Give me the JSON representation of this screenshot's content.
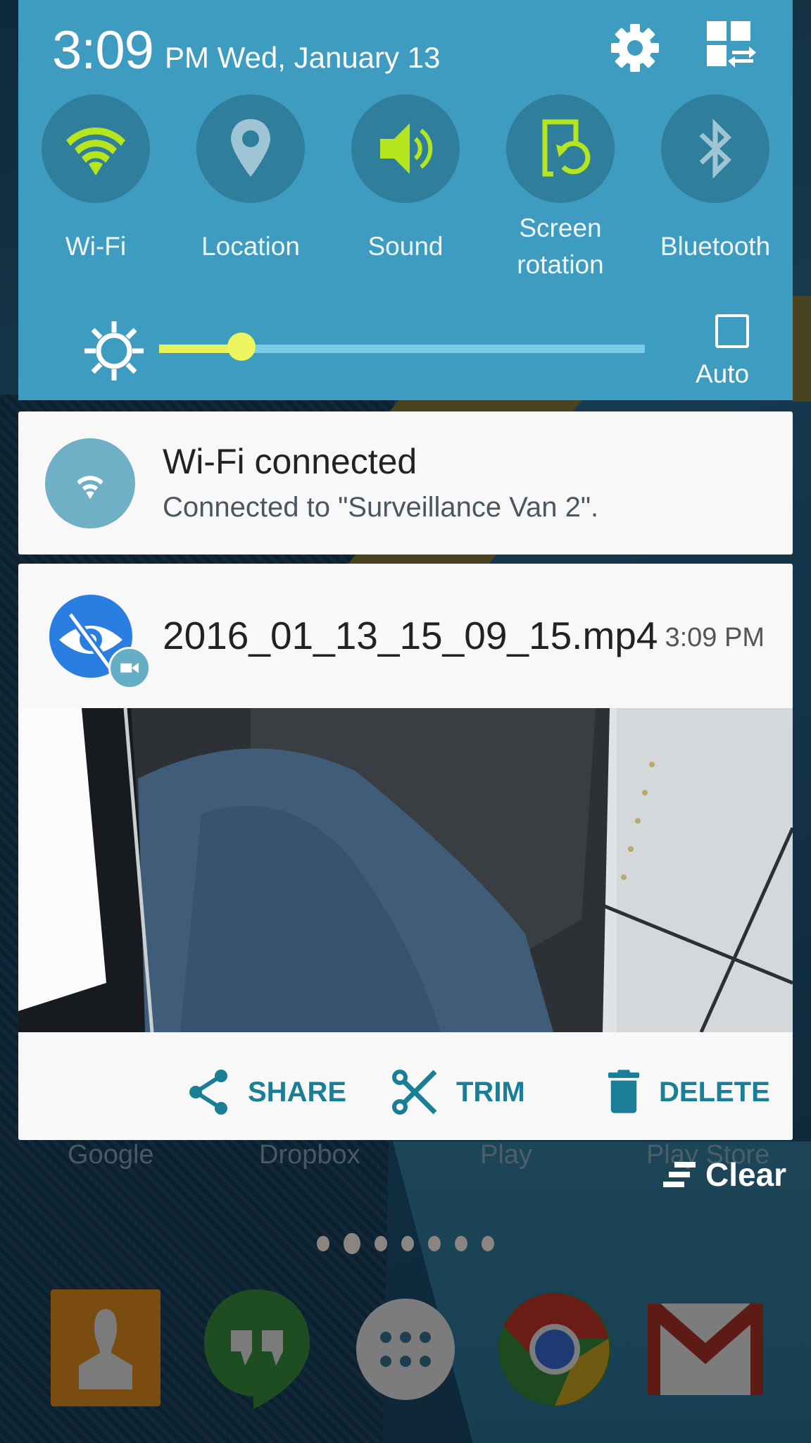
{
  "status": {
    "time": "3:09",
    "date": "PM Wed, January 13",
    "settings_icon": "gear-icon",
    "edit_icon": "quick-settings-edit-icon"
  },
  "quick_toggles": [
    {
      "label": "Wi-Fi",
      "icon": "wifi-icon",
      "state": "on"
    },
    {
      "label": "Location",
      "icon": "location-pin-icon",
      "state": "off"
    },
    {
      "label": "Sound",
      "icon": "speaker-icon",
      "state": "on"
    },
    {
      "label": "Screen rotation",
      "icon": "screen-rotation-icon",
      "state": "on"
    },
    {
      "label": "Bluetooth",
      "icon": "bluetooth-icon",
      "state": "off"
    }
  ],
  "brightness": {
    "level_fraction": 0.17,
    "auto_label": "Auto",
    "auto_checked": false
  },
  "notifications": {
    "wifi": {
      "title": "Wi-Fi connected",
      "subtitle": "Connected to \"Surveillance Van 2\"."
    },
    "video": {
      "title": "2016_01_13_15_09_15.mp4",
      "time": "3:09 PM",
      "actions": [
        {
          "label": "SHARE",
          "icon": "share-icon"
        },
        {
          "label": "TRIM",
          "icon": "scissors-icon"
        },
        {
          "label": "DELETE",
          "icon": "trash-icon"
        }
      ]
    },
    "clear_label": "Clear"
  },
  "home": {
    "app_labels": [
      "Google",
      "Dropbox",
      "Play",
      "Play Store"
    ],
    "page_count": 7,
    "active_page": 1,
    "dock": [
      "Contacts",
      "Hangouts",
      "Apps",
      "Chrome",
      "Gmail"
    ]
  },
  "colors": {
    "panel": "#3d9cc0",
    "toggle_on": "#b5e61d",
    "toggle_off": "#9fc4d3",
    "action_text": "#1a7f96"
  }
}
